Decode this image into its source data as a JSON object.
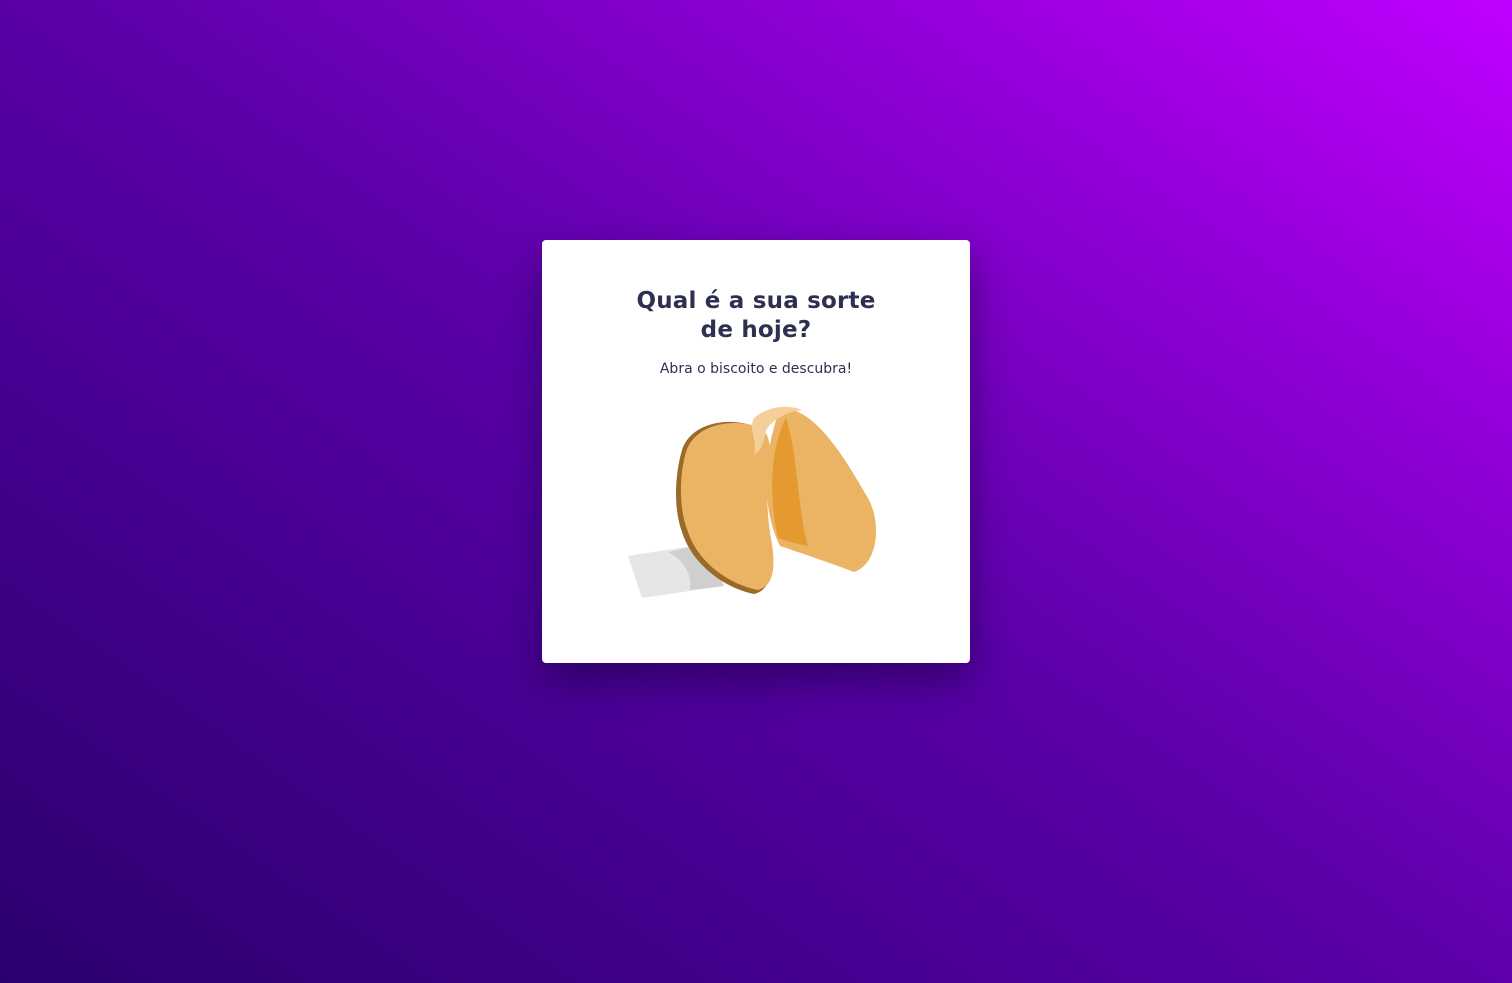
{
  "card": {
    "title": "Qual é a sua sorte de hoje?",
    "subtitle": "Abra o biscoito e descubra!"
  },
  "cookie": {
    "icon": "fortune-cookie-icon",
    "colors": {
      "dough": "#ebb465",
      "dough_dark": "#e49a30",
      "dough_shadow": "#9a6a28",
      "highlight": "#f5cf9a",
      "paper": "#e6e6e6",
      "paper_shadow": "#cfcfcf"
    }
  },
  "theme": {
    "text": "#2e3050",
    "gradient_start": "#2a006e",
    "gradient_end": "#c000ff"
  }
}
